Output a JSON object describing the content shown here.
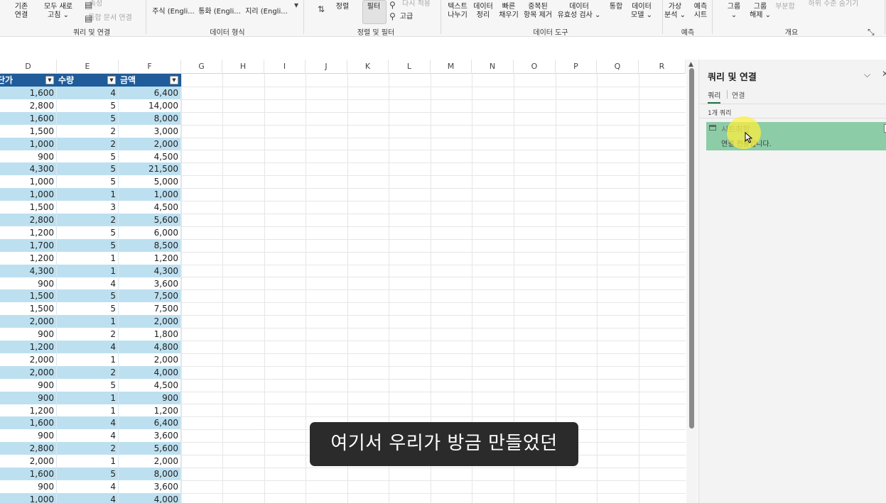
{
  "ribbon": {
    "buttons": [
      {
        "key": "existing_conn",
        "label": "기존\n연결"
      },
      {
        "key": "refresh_all",
        "label": "모두 새로\n고침 ⌄"
      },
      {
        "key": "properties",
        "label": "속성"
      },
      {
        "key": "edit_links",
        "label": "통합 문서 연결"
      },
      {
        "key": "stocks",
        "label": "주식 (Engli..."
      },
      {
        "key": "currency",
        "label": "통화 (Engli..."
      },
      {
        "key": "geography",
        "label": "지리 (Engli..."
      },
      {
        "key": "sort",
        "label": "정렬"
      },
      {
        "key": "filter",
        "label": "필터"
      },
      {
        "key": "reapply",
        "label": "다시 적용"
      },
      {
        "key": "advanced",
        "label": "고급"
      },
      {
        "key": "text_to_cols",
        "label": "텍스트\n나누기"
      },
      {
        "key": "data_cleanup",
        "label": "데이터\n정리"
      },
      {
        "key": "flash_fill",
        "label": "빠른\n채우기"
      },
      {
        "key": "remove_dupes",
        "label": "중복된\n항목 제거"
      },
      {
        "key": "validation",
        "label": "데이터\n유효성 검사 ⌄"
      },
      {
        "key": "consolidate",
        "label": "통합"
      },
      {
        "key": "data_model",
        "label": "데이터\n모델 ⌄"
      },
      {
        "key": "what_if",
        "label": "가상\n분석 ⌄"
      },
      {
        "key": "forecast_sheet",
        "label": "예측\n시트"
      },
      {
        "key": "group",
        "label": "그룹\n⌄"
      },
      {
        "key": "ungroup",
        "label": "그룹\n해제 ⌄"
      },
      {
        "key": "subtotal",
        "label": "부분합"
      },
      {
        "key": "hide_detail",
        "label": "하위 수준 숨기기"
      }
    ],
    "groups": [
      {
        "key": "queries",
        "label": "쿼리 및 연결"
      },
      {
        "key": "datatypes",
        "label": "데이터 형식"
      },
      {
        "key": "sortfilter",
        "label": "정렬 및 필터"
      },
      {
        "key": "datatools",
        "label": "데이터 도구"
      },
      {
        "key": "forecast",
        "label": "예측"
      },
      {
        "key": "outline",
        "label": "개요"
      }
    ]
  },
  "columns": [
    "D",
    "E",
    "F",
    "G",
    "H",
    "I",
    "J",
    "K",
    "L",
    "M",
    "N",
    "O",
    "P",
    "Q",
    "R"
  ],
  "table": {
    "headers": [
      "단가",
      "수량",
      "금액"
    ],
    "rows": [
      [
        "1,600",
        "4",
        "6,400"
      ],
      [
        "2,800",
        "5",
        "14,000"
      ],
      [
        "1,600",
        "5",
        "8,000"
      ],
      [
        "1,500",
        "2",
        "3,000"
      ],
      [
        "1,000",
        "2",
        "2,000"
      ],
      [
        "900",
        "5",
        "4,500"
      ],
      [
        "4,300",
        "5",
        "21,500"
      ],
      [
        "1,000",
        "5",
        "5,000"
      ],
      [
        "1,000",
        "1",
        "1,000"
      ],
      [
        "1,500",
        "3",
        "4,500"
      ],
      [
        "2,800",
        "2",
        "5,600"
      ],
      [
        "1,200",
        "5",
        "6,000"
      ],
      [
        "1,700",
        "5",
        "8,500"
      ],
      [
        "1,200",
        "1",
        "1,200"
      ],
      [
        "4,300",
        "1",
        "4,300"
      ],
      [
        "900",
        "4",
        "3,600"
      ],
      [
        "1,500",
        "5",
        "7,500"
      ],
      [
        "1,500",
        "5",
        "7,500"
      ],
      [
        "2,000",
        "1",
        "2,000"
      ],
      [
        "900",
        "2",
        "1,800"
      ],
      [
        "1,200",
        "4",
        "4,800"
      ],
      [
        "2,000",
        "1",
        "2,000"
      ],
      [
        "2,000",
        "2",
        "4,000"
      ],
      [
        "900",
        "5",
        "4,500"
      ],
      [
        "900",
        "1",
        "900"
      ],
      [
        "1,200",
        "1",
        "1,200"
      ],
      [
        "1,600",
        "4",
        "6,400"
      ],
      [
        "900",
        "4",
        "3,600"
      ],
      [
        "2,800",
        "2",
        "5,600"
      ],
      [
        "2,000",
        "1",
        "2,000"
      ],
      [
        "1,600",
        "5",
        "8,000"
      ],
      [
        "900",
        "4",
        "3,600"
      ],
      [
        "1,000",
        "4",
        "4,000"
      ]
    ]
  },
  "pane": {
    "title": "쿼리 및 연결",
    "tabs": [
      "쿼리",
      "연결"
    ],
    "query_count": "1개 쿼리",
    "query": {
      "name": "시트취합",
      "status": "연결 전용입니다."
    }
  },
  "subtitle": "여기서 우리가 방금 만들었던",
  "colors": {
    "table_header": "#1f5c99",
    "band": "#bde0f0",
    "query_selected": "#8ccca6",
    "active_tab": "#1e7145"
  }
}
